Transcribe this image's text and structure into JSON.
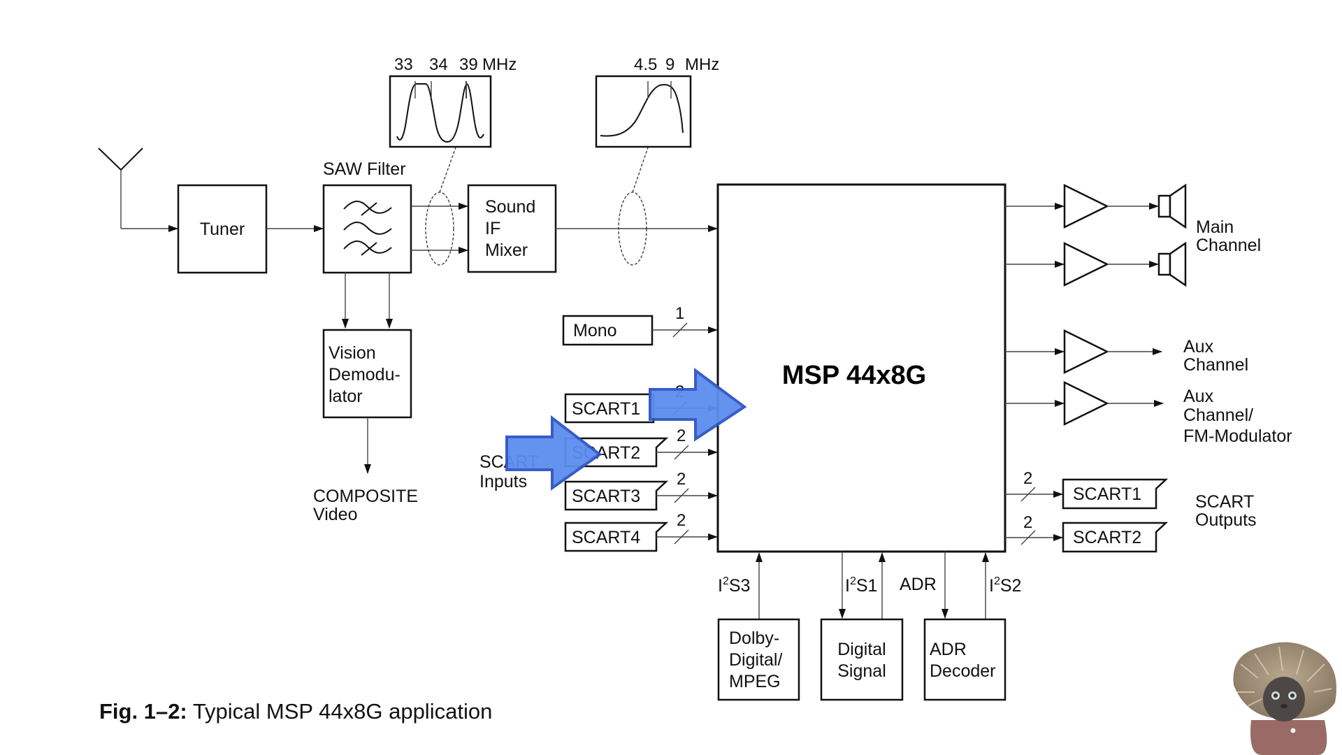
{
  "figure": {
    "caption_bold": "Fig. 1–2:",
    "caption_text": " Typical MSP 44x8G application"
  },
  "blocks": {
    "tuner": "Tuner",
    "saw_filter_label": "SAW Filter",
    "sound_if_mixer": [
      "Sound",
      "IF",
      "Mixer"
    ],
    "vision_demodulator": [
      "Vision",
      "Demodu-",
      "lator"
    ],
    "composite_video": [
      "COMPOSITE",
      "Video"
    ],
    "msp": "MSP 44x8G",
    "mono": "Mono",
    "dolby": [
      "Dolby-",
      "Digital/",
      "MPEG"
    ],
    "digital_signal": [
      "Digital",
      "Signal"
    ],
    "adr_decoder": [
      "ADR",
      "Decoder"
    ]
  },
  "filter_plots": {
    "saw": {
      "labels": [
        "33",
        "34",
        "39",
        "MHz"
      ]
    },
    "sound": {
      "labels": [
        "4.5",
        "9",
        "MHz"
      ]
    }
  },
  "scart_inputs": {
    "label": [
      "SCART",
      "Inputs"
    ],
    "items": [
      {
        "name": "SCART1",
        "bus": "2"
      },
      {
        "name": "SCART2",
        "bus": "2"
      },
      {
        "name": "SCART3",
        "bus": "2"
      },
      {
        "name": "SCART4",
        "bus": "2"
      }
    ],
    "mono_bus": "1"
  },
  "outputs": {
    "main_channel": [
      "Main",
      "Channel"
    ],
    "aux_channel": [
      "Aux",
      "Channel"
    ],
    "aux_fm": [
      "Aux",
      "Channel/",
      "FM-Modulator"
    ],
    "scart_outputs_label": [
      "SCART",
      "Outputs"
    ],
    "scart_outputs": [
      {
        "name": "SCART1",
        "bus": "2"
      },
      {
        "name": "SCART2",
        "bus": "2"
      }
    ]
  },
  "bottom_buses": {
    "i2s3": {
      "prefix": "I",
      "sup": "2",
      "suffix": "S3"
    },
    "i2s1": {
      "prefix": "I",
      "sup": "2",
      "suffix": "S1"
    },
    "adr": "ADR",
    "i2s2": {
      "prefix": "I",
      "sup": "2",
      "suffix": "S2"
    }
  },
  "overlay": {
    "arrow_color": "#5b8def",
    "arrow_outline": "#2f55c4"
  }
}
